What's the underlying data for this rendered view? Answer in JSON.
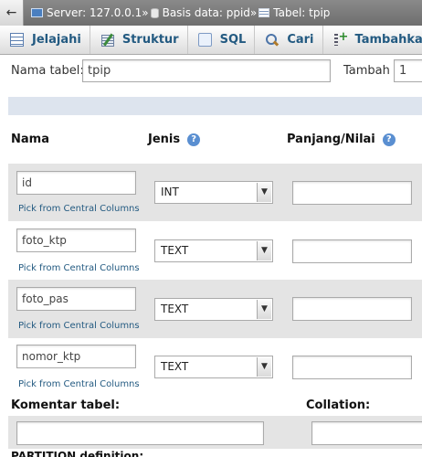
{
  "breadcrumb": {
    "back_glyph": "←",
    "server": "Server: 127.0.0.1",
    "separator": "»",
    "database": "Basis data: ppid",
    "table": "Tabel: tpip"
  },
  "tabs": [
    {
      "label": "Jelajahi",
      "icon": "browse-icon"
    },
    {
      "label": "Struktur",
      "icon": "structure-icon"
    },
    {
      "label": "SQL",
      "icon": "sql-icon"
    },
    {
      "label": "Cari",
      "icon": "search-icon"
    },
    {
      "label": "Tambahkan",
      "icon": "insert-icon"
    }
  ],
  "table_form": {
    "name_label": "Nama tabel:",
    "name_value": "tpip",
    "add_label": "Tambah",
    "add_value": "1"
  },
  "columns_header": {
    "name": "Nama",
    "type": "Jenis",
    "length": "Panjang/Nilai",
    "help_glyph": "?"
  },
  "fields": [
    {
      "name": "id",
      "type": "INT",
      "length": "",
      "pick_link": "Pick from Central Columns"
    },
    {
      "name": "foto_ktp",
      "type": "TEXT",
      "length": "",
      "pick_link": "Pick from Central Columns"
    },
    {
      "name": "foto_pas",
      "type": "TEXT",
      "length": "",
      "pick_link": "Pick from Central Columns"
    },
    {
      "name": "nomor_ktp",
      "type": "TEXT",
      "length": "",
      "pick_link": "Pick from Central Columns"
    }
  ],
  "footer": {
    "comment_label": "Komentar tabel:",
    "collation_label": "Collation:",
    "partition_label": "PARTITION definition:"
  },
  "colors": {
    "link": "#235a81",
    "row_odd": "#e4e4e4",
    "band": "#dde4ee"
  }
}
